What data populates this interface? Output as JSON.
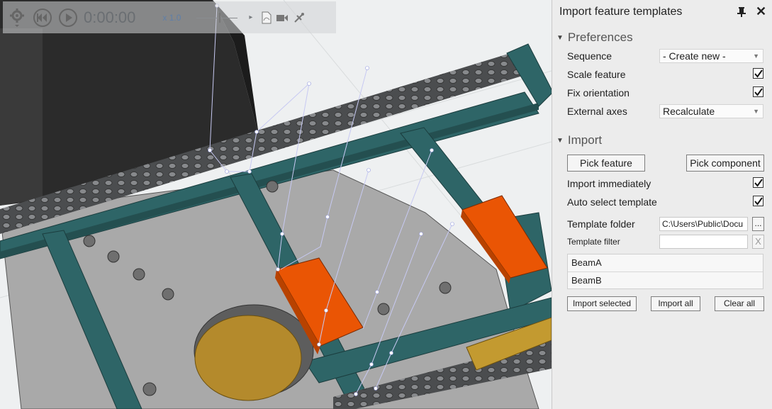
{
  "playback": {
    "time": "0:00:00",
    "speed": "x 1.0",
    "icons": [
      "gear-icon",
      "rewind-icon",
      "play-icon",
      "pdf-icon",
      "video-camera-icon",
      "satellite-icon"
    ]
  },
  "panel": {
    "title": "Import feature templates",
    "preferences": {
      "heading": "Preferences",
      "sequence_label": "Sequence",
      "sequence_value": "- Create new -",
      "scale_feature_label": "Scale feature",
      "scale_feature_checked": true,
      "fix_orientation_label": "Fix orientation",
      "fix_orientation_checked": true,
      "external_axes_label": "External axes",
      "external_axes_value": "Recalculate"
    },
    "import": {
      "heading": "Import",
      "pick_feature_label": "Pick feature",
      "pick_component_label": "Pick component",
      "import_immediately_label": "Import immediately",
      "import_immediately_checked": true,
      "auto_select_label": "Auto select template",
      "auto_select_checked": true,
      "template_folder_label": "Template folder",
      "template_folder_value": "C:\\Users\\Public\\Docu",
      "browse_label": "...",
      "template_filter_label": "Template filter",
      "template_filter_value": "",
      "clear_filter_label": "X",
      "templates": [
        "BeamA",
        "BeamB"
      ],
      "import_selected_label": "Import selected",
      "import_all_label": "Import all",
      "clear_all_label": "Clear all"
    }
  },
  "colors": {
    "frame_beam": "#2e6567",
    "plate": "#a8a8a8",
    "orange_part": "#ea5504",
    "yellow_disc": "#b48a2c",
    "rail": "#4a4c4e",
    "panel_bg": "#ececec"
  }
}
